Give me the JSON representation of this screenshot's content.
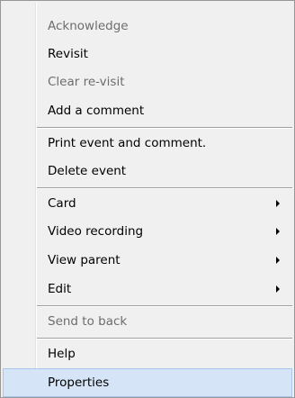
{
  "context_menu": {
    "items": [
      {
        "label": "Acknowledge",
        "enabled": false
      },
      {
        "label": "Revisit",
        "enabled": true
      },
      {
        "label": "Clear re-visit",
        "enabled": false
      },
      {
        "label": "Add a comment",
        "enabled": true
      },
      {
        "label": "Print event and comment.",
        "enabled": true
      },
      {
        "label": "Delete event",
        "enabled": true
      },
      {
        "label": "Card",
        "enabled": true,
        "submenu": true
      },
      {
        "label": "Video recording",
        "enabled": true,
        "submenu": true
      },
      {
        "label": "View parent",
        "enabled": true,
        "submenu": true
      },
      {
        "label": "Edit",
        "enabled": true,
        "submenu": true
      },
      {
        "label": "Send to back",
        "enabled": false
      },
      {
        "label": "Help",
        "enabled": true
      },
      {
        "label": "Properties",
        "enabled": true,
        "selected": true
      }
    ]
  },
  "colors": {
    "menu_background": "#f0f0f0",
    "menu_border": "#979797",
    "disabled_text": "#6d6d6d",
    "highlight_background": "#d5e4f7",
    "highlight_border": "#a9c6ea",
    "separator": "#a0a0a0"
  },
  "icons": {
    "submenu_indicator": "submenu-arrow-icon"
  }
}
